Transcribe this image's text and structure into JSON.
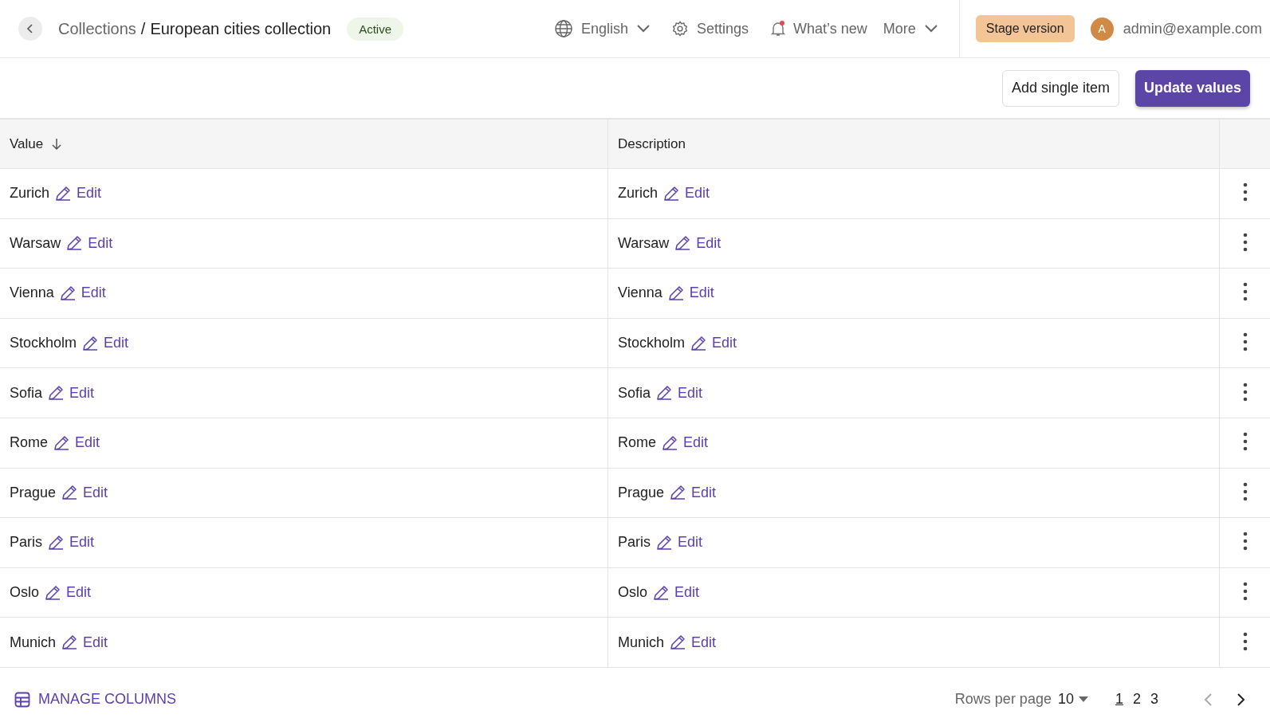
{
  "header": {
    "breadcrumb_separator": "/",
    "breadcrumb": [
      {
        "label": "Collections"
      },
      {
        "label": "European cities collection"
      }
    ],
    "status_badge": "Active",
    "language": "English",
    "settings": "Settings",
    "whats_new": {
      "label": "What’s new",
      "unread": true
    },
    "more": "More",
    "stage_button": "Stage version",
    "user": {
      "initial": "A",
      "email": "admin@example.com"
    }
  },
  "toolbar": {
    "buttons": [
      {
        "label": "Add single item",
        "kind": "secondary"
      },
      {
        "label": "Update values",
        "kind": "primary"
      }
    ]
  },
  "table": {
    "columns": [
      {
        "label": "Value",
        "sorted": true
      },
      {
        "label": "Description",
        "sorted": false
      }
    ],
    "rows": [
      {
        "value": "Zurich",
        "value_edit": "Edit",
        "description": "Zurich",
        "description_edit": "Edit"
      },
      {
        "value": "Warsaw",
        "value_edit": "Edit",
        "description": "Warsaw",
        "description_edit": "Edit"
      },
      {
        "value": "Vienna",
        "value_edit": "Edit",
        "description": "Vienna",
        "description_edit": "Edit"
      },
      {
        "value": "Stockholm",
        "value_edit": "Edit",
        "description": "Stockholm",
        "description_edit": "Edit"
      },
      {
        "value": "Sofia",
        "value_edit": "Edit",
        "description": "Sofia",
        "description_edit": "Edit"
      },
      {
        "value": "Rome",
        "value_edit": "Edit",
        "description": "Rome",
        "description_edit": "Edit"
      },
      {
        "value": "Prague",
        "value_edit": "Edit",
        "description": "Prague",
        "description_edit": "Edit"
      },
      {
        "value": "Paris",
        "value_edit": "Edit",
        "description": "Paris",
        "description_edit": "Edit"
      },
      {
        "value": "Oslo",
        "value_edit": "Edit",
        "description": "Oslo",
        "description_edit": "Edit"
      },
      {
        "value": "Munich",
        "value_edit": "Edit",
        "description": "Munich",
        "description_edit": "Edit"
      }
    ]
  },
  "footer": {
    "manage_columns": "MANAGE COLUMNS",
    "rows_per_page_label": "Rows per page",
    "rows_per_page": "10",
    "pages": [
      {
        "label": "1",
        "selected": true
      },
      {
        "label": "2",
        "selected": false
      },
      {
        "label": "3",
        "selected": false
      }
    ],
    "prev": {
      "disabled": true
    },
    "next": {
      "disabled": false
    }
  }
}
